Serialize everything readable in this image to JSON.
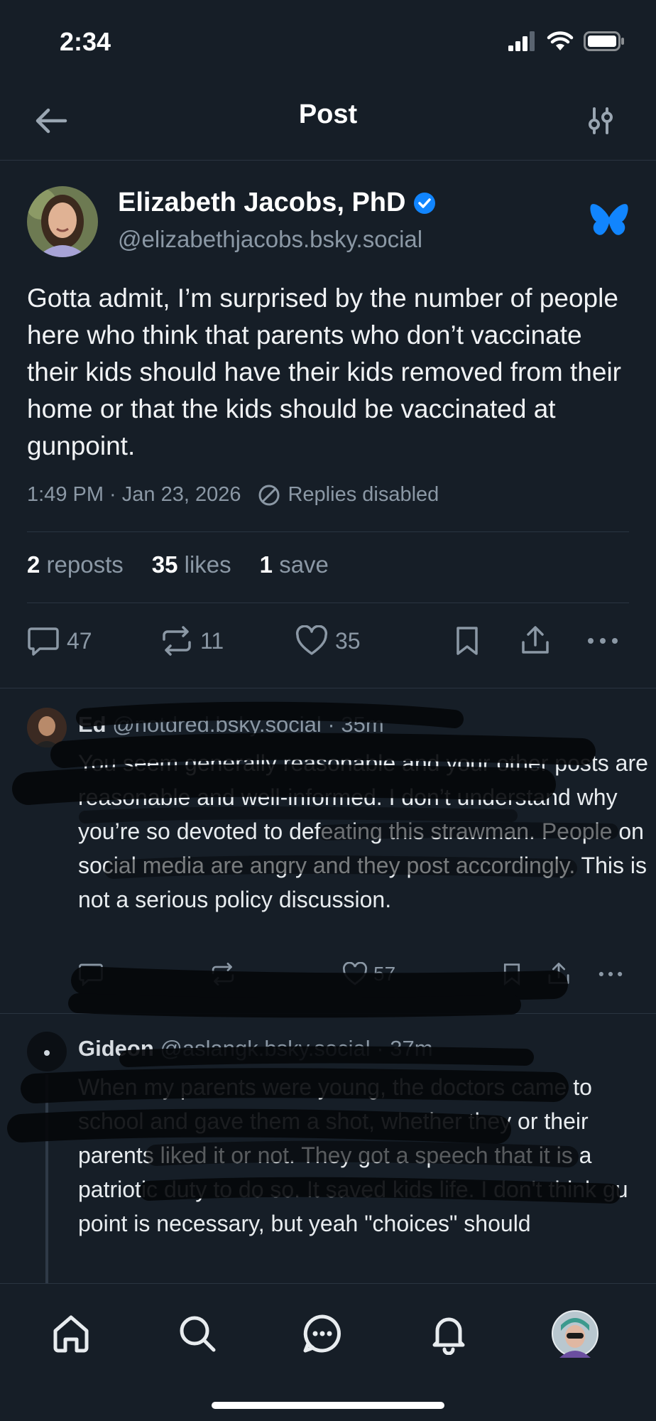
{
  "status_bar": {
    "time": "2:34"
  },
  "header": {
    "title": "Post"
  },
  "post": {
    "author_name": "Elizabeth Jacobs, PhD",
    "author_handle": "@elizabethjacobs.bsky.social",
    "text": "Gotta admit, I’m surprised by the number of people here who think that parents who don’t vaccinate their kids should have their kids removed from their home or that the kids should be vaccinated at gunpoint.",
    "timestamp": "1:49 PM · Jan 23, 2026",
    "replies_status": "Replies disabled",
    "stats": {
      "reposts_count": "2",
      "reposts_label": "reposts",
      "likes_count": "35",
      "likes_label": "likes",
      "saves_count": "1",
      "saves_label": "save"
    },
    "actions": {
      "reply_count": "47",
      "repost_count": "11",
      "like_count": "35"
    }
  },
  "replies": [
    {
      "name": "Ed",
      "handle": "@notdred.bsky.social",
      "time": "· 35m",
      "text": "You seem generally reasonable and your other posts are reasonable and well-informed. I don’t understand why you’re so devoted to defeating this strawman. People on social media are angry and they post accordingly. This is not a serious policy discussion.",
      "like_count": "57"
    },
    {
      "name": "Gideon",
      "handle": "@aslangk.bsky.social",
      "time": "· 37m",
      "text": "When my parents were young, the doctors came to school and gave them a shot, whether they or their parents liked it or not. They got a speech that it is a patriotic duty to do so. It saved kids life.  I don't think gun point is necessary, but yeah \"choices\" should"
    }
  ],
  "icons": {
    "back": "arrow-left-icon",
    "settings": "sliders-icon",
    "verified": "verified-check-icon",
    "brand": "butterfly-icon",
    "nav": [
      "home-icon",
      "search-icon",
      "chat-icon",
      "bell-icon",
      "profile-avatar"
    ]
  },
  "colors": {
    "background": "#161e27",
    "accent": "#1185fe",
    "muted": "#8b98a5"
  }
}
